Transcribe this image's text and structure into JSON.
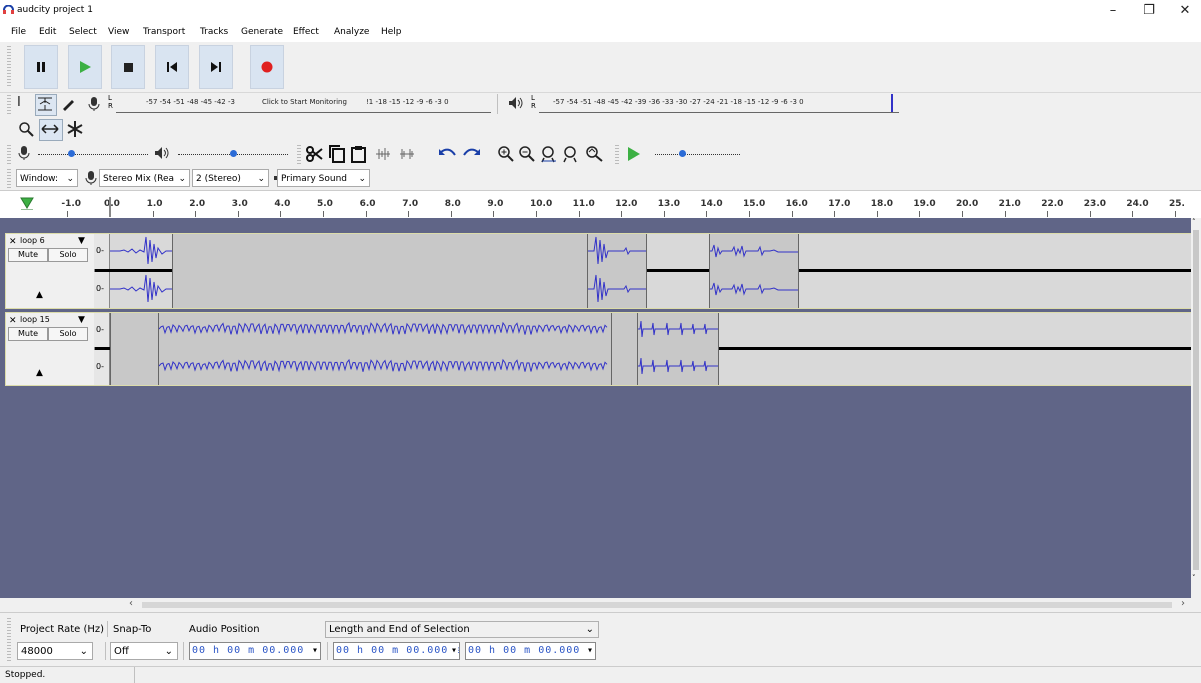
{
  "window": {
    "title": "audcity project 1",
    "minimize": "–",
    "maximize": "❐",
    "close": "✕"
  },
  "menu": [
    "File",
    "Edit",
    "Select",
    "View",
    "Transport",
    "Tracks",
    "Generate",
    "Effect",
    "Analyze",
    "Help"
  ],
  "meters": {
    "record_scale": "-57 -54 -51 -48 -45 -42 -3",
    "record_hint": "Click to Start Monitoring",
    "record_scale_end": "!1 -18 -15 -12  -9  -6  -3  0",
    "playback_scale": "-57 -54 -51 -48 -45 -42 -39 -36 -33 -30 -27 -24 -21 -18 -15 -12  -9  -6  -3  0",
    "lr_top": "L",
    "lr_bottom": "R"
  },
  "devices": {
    "host": "Window:",
    "recording": "Stereo Mix (Rea",
    "channels": "2 (Stereo)",
    "playback": "Primary Sound"
  },
  "ruler": [
    "-1.0",
    "0.0",
    "1.0",
    "2.0",
    "3.0",
    "4.0",
    "5.0",
    "6.0",
    "7.0",
    "8.0",
    "9.0",
    "10.0",
    "11.0",
    "12.0",
    "13.0",
    "14.0",
    "15.0",
    "16.0",
    "17.0",
    "18.0",
    "19.0",
    "20.0",
    "21.0",
    "22.0",
    "23.0",
    "24.0",
    "25."
  ],
  "tracks": [
    {
      "name": "loop 6",
      "mute": "Mute",
      "solo": "Solo",
      "zero": "0-"
    },
    {
      "name": "loop 15",
      "mute": "Mute",
      "solo": "Solo",
      "zero": "0-"
    }
  ],
  "selection": {
    "project_rate_label": "Project Rate (Hz)",
    "snap_label": "Snap-To",
    "audio_pos_label": "Audio Position",
    "length_label": "Length and End of Selection",
    "rate": "48000",
    "snap": "Off",
    "time1": "00 h 00 m 00.000 s",
    "time2": "00 h 00 m 00.000 s",
    "time3": "00 h 00 m 00.000 s"
  },
  "status": "Stopped.",
  "colors": {
    "accent": "#3232c8",
    "track_bg": "#606587",
    "record": "#e02020",
    "play": "#3cb043"
  }
}
